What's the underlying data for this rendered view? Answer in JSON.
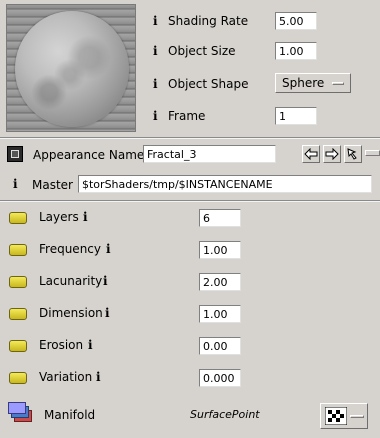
{
  "preview": {},
  "render": {
    "shading_rate": {
      "label": "Shading Rate",
      "value": "5.00"
    },
    "object_size": {
      "label": "Object Size",
      "value": "1.00"
    },
    "object_shape": {
      "label": "Object Shape",
      "value": "Sphere"
    },
    "frame": {
      "label": "Frame",
      "value": "1"
    }
  },
  "appearance": {
    "label": "Appearance Name",
    "value": "Fractal_3"
  },
  "master": {
    "label": "Master",
    "value": "$torShaders/tmp/$INSTANCENAME"
  },
  "params": [
    {
      "label": "Layers",
      "value": "6"
    },
    {
      "label": "Frequency",
      "value": "1.00"
    },
    {
      "label": "Lacunarity",
      "value": "2.00"
    },
    {
      "label": "Dimension",
      "value": "1.00"
    },
    {
      "label": "Erosion",
      "value": "0.00"
    },
    {
      "label": "Variation",
      "value": "0.000"
    }
  ],
  "manifold": {
    "label": "Manifold",
    "type": "SurfacePoint"
  },
  "info_glyph": "i",
  "icons": {
    "arrow-left": "left-arrow-icon",
    "arrow-right": "right-arrow-icon",
    "pointer": "pointer-icon",
    "checker": "checker-icon"
  }
}
